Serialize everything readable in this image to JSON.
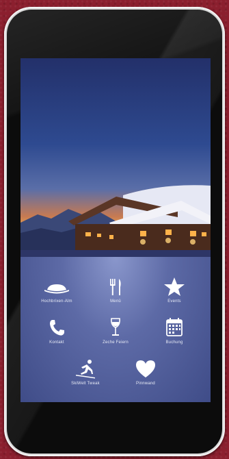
{
  "menu": {
    "items": [
      {
        "id": "about",
        "label": "Hochbrixen-Alm",
        "icon": "hat-icon"
      },
      {
        "id": "menu",
        "label": "Menü",
        "icon": "cutlery-icon"
      },
      {
        "id": "events",
        "label": "Events",
        "icon": "star-icon"
      },
      {
        "id": "contact",
        "label": "Kontakt",
        "icon": "phone-icon"
      },
      {
        "id": "celebrate",
        "label": "Zeche Feiern",
        "icon": "wine-glass-icon"
      },
      {
        "id": "booking",
        "label": "Buchung",
        "icon": "calendar-icon"
      },
      {
        "id": "ski",
        "label": "SkiWelt Tweak",
        "icon": "skier-icon"
      },
      {
        "id": "favorites",
        "label": "Pinnwand",
        "icon": "heart-icon"
      }
    ]
  },
  "colors": {
    "background": "#8b1f2e",
    "phone_frame": "#d9d9d9",
    "screen_sky": "#2e4a90"
  }
}
